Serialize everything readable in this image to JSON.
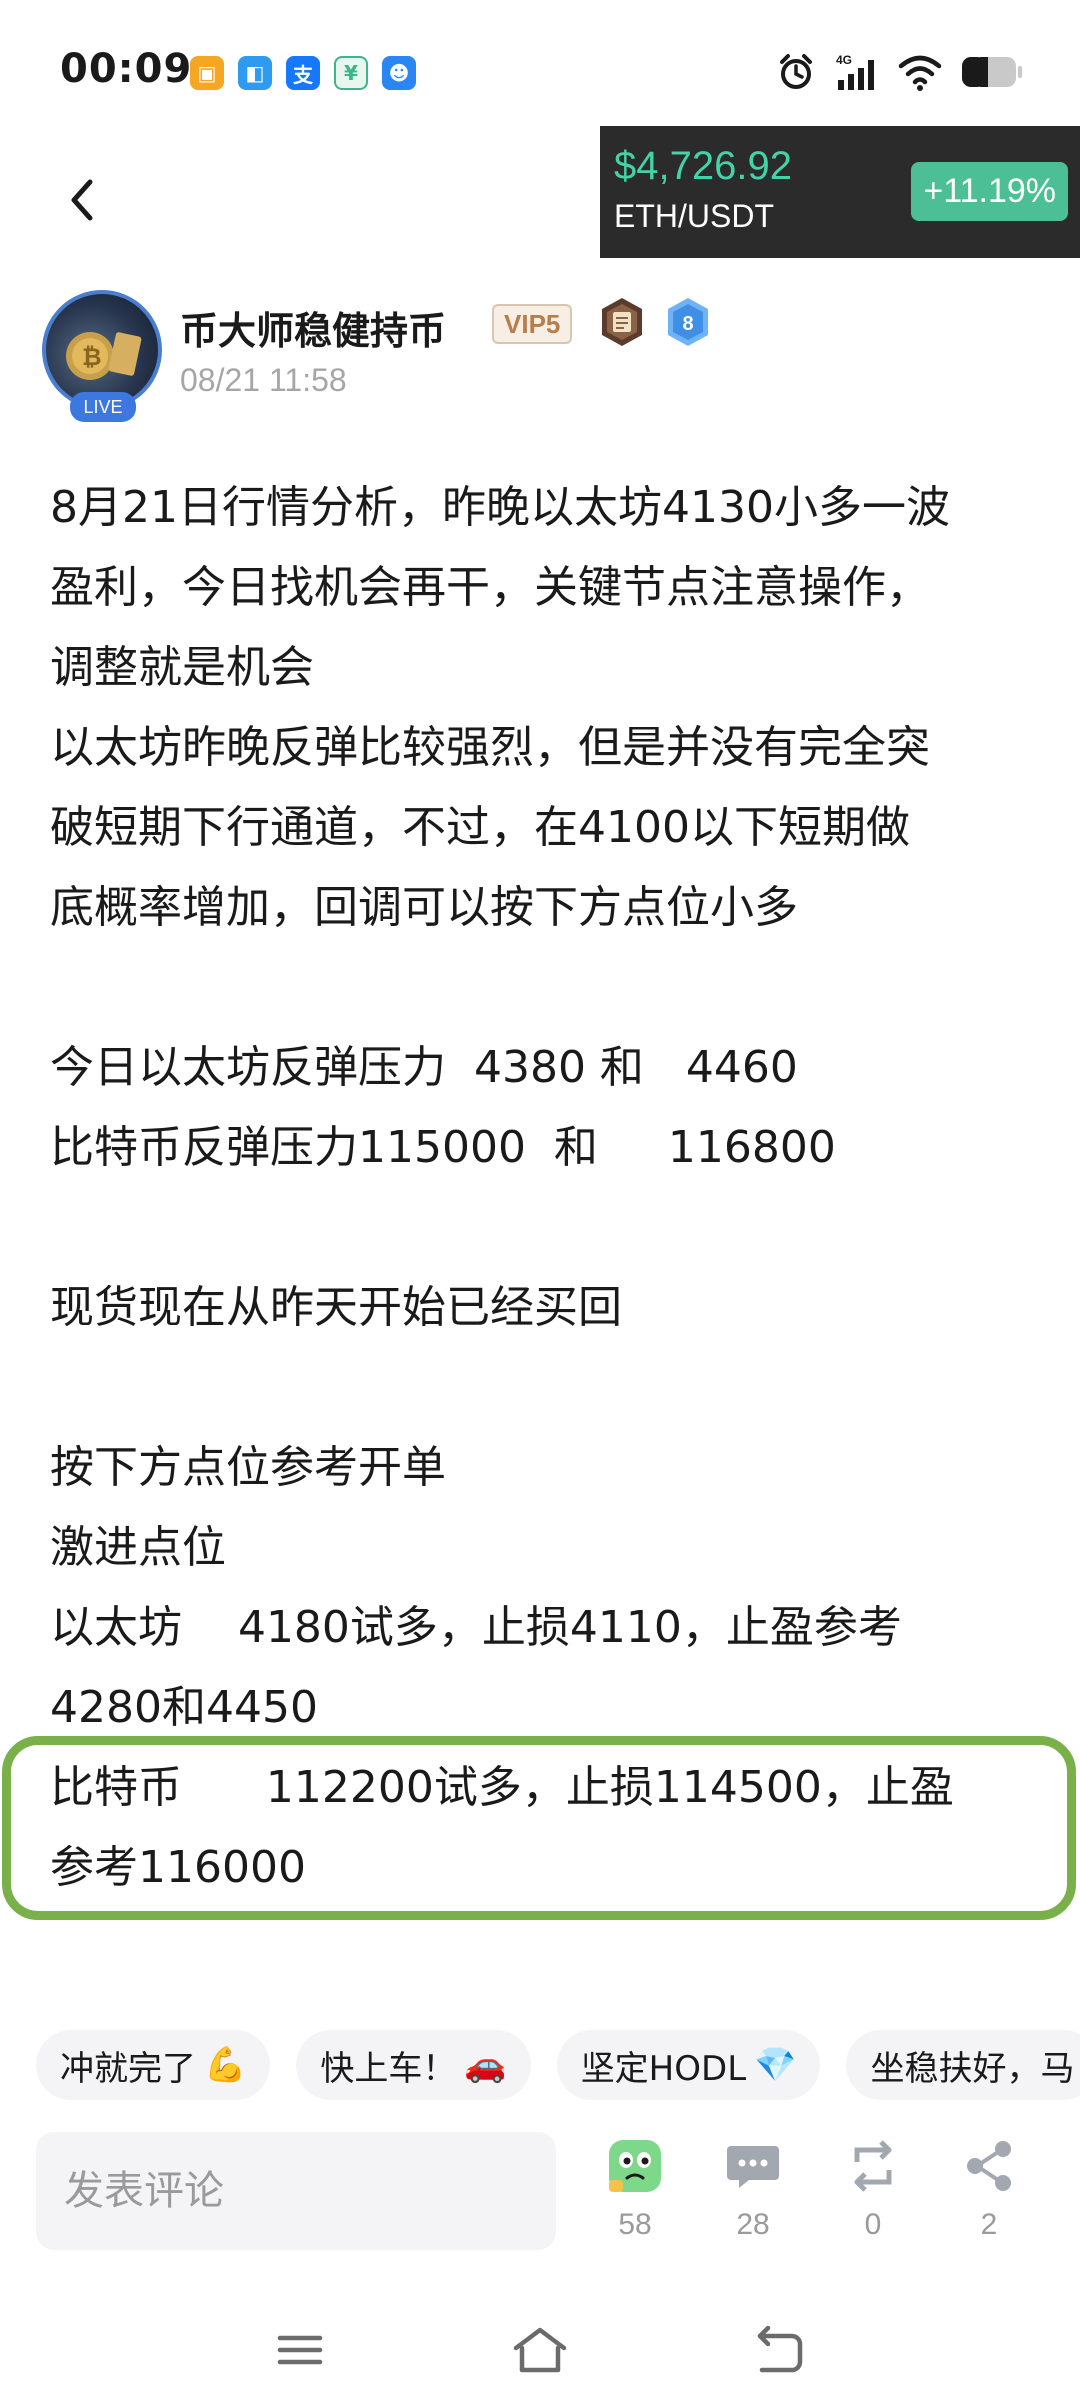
{
  "status_bar": {
    "time": "00:09",
    "notification_icons": [
      {
        "name": "app-notif-orange-icon",
        "color": "#f5a623",
        "glyph": "▣"
      },
      {
        "name": "app-notif-blue-icon",
        "color": "#2f9bf0",
        "glyph": "◧"
      },
      {
        "name": "alipay-icon",
        "color": "#1677ff",
        "glyph": "支"
      },
      {
        "name": "app-notif-green-icon",
        "color": "#3bb58a",
        "glyph": "¥"
      },
      {
        "name": "app-notif-robot-icon",
        "color": "#2a86f3",
        "glyph": "☻"
      }
    ],
    "network_label": "4G"
  },
  "ticker": {
    "price": "$4,726.92",
    "pair": "ETH/USDT",
    "change": "+11.19%"
  },
  "author": {
    "name": "币大师稳健持币",
    "live_label": "LIVE",
    "vip_label": "VIP5",
    "rank_number": "8",
    "post_time": "08/21 11:58"
  },
  "post": {
    "lines": [
      "8月21日行情分析，昨晚以太坊4130小多一波",
      "盈利，今日找机会再干，关键节点注意操作，",
      "调整就是机会",
      "以太坊昨晚反弹比较强烈，但是并没有完全突",
      "破短期下行通道，不过，在4100以下短期做",
      "底概率增加，回调可以按下方点位小多",
      "",
      "今日以太坊反弹压力  4380 和   4460",
      "比特币反弹压力115000  和     116800",
      "",
      "现货现在从昨天开始已经买回",
      "",
      "按下方点位参考开单",
      "激进点位",
      "以太坊    4180试多，止损4110，止盈参考",
      "4280和4450",
      "比特币      112200试多，止损114500，止盈",
      "参考116000"
    ]
  },
  "reactions": [
    {
      "label": "冲就完了",
      "emoji": "💪"
    },
    {
      "label": "快上车！",
      "emoji": "🚗"
    },
    {
      "label": "坚定HODL",
      "emoji": "💎"
    },
    {
      "label": "坐稳扶好，马",
      "emoji": ""
    }
  ],
  "comment": {
    "placeholder": "发表评论"
  },
  "actions": {
    "like_count": "58",
    "comment_count": "28",
    "repost_count": "0",
    "share_count": "2"
  },
  "colors": {
    "accent_green": "#43d3a6",
    "highlight_border": "#7ab04a",
    "vip_text": "#b77d4a"
  }
}
